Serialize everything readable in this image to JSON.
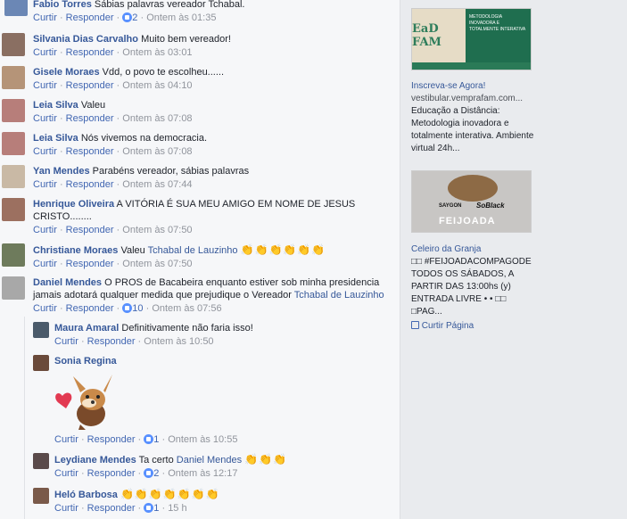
{
  "comments": [
    {
      "author": "Fabio Torres",
      "text": "Sábias palavras vereador Tchabal.",
      "like": "Curtir",
      "reply": "Responder",
      "likes": "2",
      "time": "Ontem às 01:35"
    },
    {
      "author": "Silvania Dias Carvalho",
      "text": "Muito bem vereador!",
      "like": "Curtir",
      "reply": "Responder",
      "time": "Ontem às 03:01"
    },
    {
      "author": "Gisele Moraes",
      "text": "Vdd, o povo te escolheu......",
      "like": "Curtir",
      "reply": "Responder",
      "time": "Ontem às 04:10"
    },
    {
      "author": "Leia Silva",
      "text": "Valeu",
      "like": "Curtir",
      "reply": "Responder",
      "time": "Ontem às 07:08"
    },
    {
      "author": "Leia Silva",
      "text": "Nós vivemos na democracia.",
      "like": "Curtir",
      "reply": "Responder",
      "time": "Ontem às 07:08"
    },
    {
      "author": "Yan Mendes",
      "text": "Parabéns vereador, sábias palavras",
      "like": "Curtir",
      "reply": "Responder",
      "time": "Ontem às 07:44"
    },
    {
      "author": "Henrique Oliveira",
      "text": "A VITÓRIA É SUA MEU AMIGO EM NOME DE JESUS CRISTO........",
      "like": "Curtir",
      "reply": "Responder",
      "time": "Ontem às 07:50"
    },
    {
      "author": "Christiane Moraes",
      "text": "Valeu",
      "mention": "Tchabal de Lauzinho",
      "like": "Curtir",
      "reply": "Responder",
      "time": "Ontem às 07:50"
    },
    {
      "author": "Daniel Mendes",
      "text": "O PROS de Bacabeira enquanto estiver sob minha presidencia jamais adotará qualquer medida que prejudique o Vereador",
      "mention": "Tchabal de Lauzinho",
      "like": "Curtir",
      "reply": "Responder",
      "likes": "10",
      "time": "Ontem às 07:56"
    }
  ],
  "replies": [
    {
      "author": "Maura Amaral",
      "text": "Definitivamente não faria isso!",
      "like": "Curtir",
      "reply": "Responder",
      "time": "Ontem às 10:50"
    },
    {
      "author": "Sonia Regina",
      "like": "Curtir",
      "reply": "Responder",
      "likes": "1",
      "time": "Ontem às 10:55"
    },
    {
      "author": "Leydiane Mendes",
      "text": "Ta certo",
      "mention": "Daniel Mendes",
      "like": "Curtir",
      "reply": "Responder",
      "likes": "2",
      "time": "Ontem às 12:17"
    },
    {
      "author": "Heló Barbosa",
      "like": "Curtir",
      "reply": "Responder",
      "likes": "1",
      "time": "15 h"
    }
  ],
  "sidebar": {
    "ad1": {
      "logo": "EaD FAM",
      "banner_text": "METODOLOGIA INOVADORA E TOTALMENTE INTERATIVA",
      "title": "Inscreva-se Agora!",
      "url": "vestibular.vemprafam.com...",
      "desc": "Educação a Distância: Metodologia inovadora e totalmente interativa. Ambiente virtual 24h..."
    },
    "ad2": {
      "brand1": "SAYGON",
      "brand2": "SoBlack",
      "banner_text": "FEIJOADA",
      "title": "Celeiro da Granja",
      "desc": "□□ #FEIJOADACOMPAGODE TODOS OS SÁBADOS, A PARTIR DAS 13:00hs (y) ENTRADA LIVRE • • □□ □PAG...",
      "like": "Curtir Página"
    }
  },
  "colors": {
    "link": "#365899",
    "action": "#4267b2",
    "meta": "#90949c",
    "clap": "#f0b429"
  }
}
